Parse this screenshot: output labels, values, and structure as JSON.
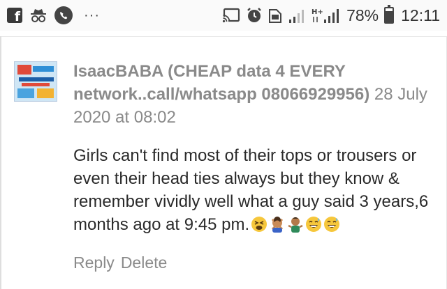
{
  "status_bar": {
    "icons": [
      "facebook-icon",
      "incognito-icon",
      "phone-icon",
      "more-dots-icon",
      "cast-icon",
      "alarm-icon",
      "data-saver-icon",
      "signal-icon",
      "hplus-signal-icon"
    ],
    "dots": "···",
    "hplus": "H+",
    "battery_percent": "78%",
    "battery_level": 0.78,
    "time": "12:11"
  },
  "comment": {
    "author": "IsaacBABA (CHEAP data 4 EVERY network..call/whatsapp 08066929956)",
    "timestamp": "28 July 2020 at 08:02",
    "text": "Girls can't find most of their tops or trousers or even their head ties always but they know & remember vividly well what a guy said 3 years,6 months ago at 9:45 pm.",
    "emojis": [
      "tired-face-emoji",
      "person-gesturing-no-emoji",
      "person-shrugging-emoji",
      "grinning-sweat-emoji",
      "grinning-sweat-emoji"
    ],
    "actions": {
      "reply": "Reply",
      "delete": "Delete"
    }
  }
}
